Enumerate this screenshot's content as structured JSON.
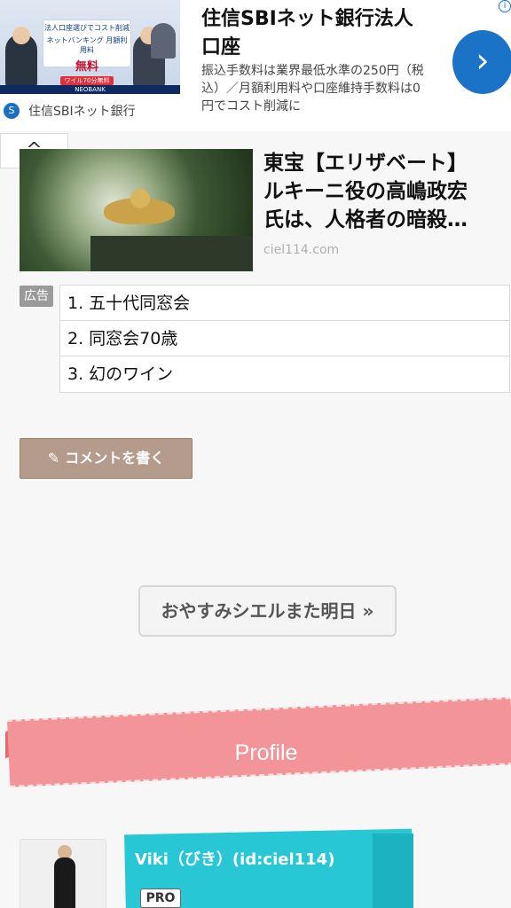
{
  "ad_banner": {
    "image_promo": {
      "line1": "法人口座選びでコスト削減",
      "line2": "ネットバンキング 月額利用料",
      "line3": "無料",
      "line4": "ワイル70分無料",
      "brand": "NEOBANK"
    },
    "title": "住信SBIネット銀行法人口座",
    "description": "振込手数料は業界最低水準の250円（税込）／月額利用料や口座維持手数料は0円でコスト削減に",
    "advertiser": "住信SBIネット銀行",
    "next_icon": "chevron-right-icon",
    "info_icon": "info-icon"
  },
  "collapse": {
    "icon": "chevron-up-icon",
    "glyph": "^"
  },
  "related_article": {
    "title_line1": "東宝【エリザベート】",
    "title_line2": "ルキーニ役の高嶋政宏",
    "title_line3": "氏は、人格者の暗殺…",
    "domain": "ciel114.com"
  },
  "ad_links": {
    "label": "広告",
    "items": [
      "1. 五十代同窓会",
      "2. 同窓会70歳",
      "3. 幻のワイン"
    ]
  },
  "comment_button": {
    "label": "コメントを書く",
    "icon": "pencil-icon"
  },
  "pager": {
    "next_label": "おやすみシエルまた明日 »"
  },
  "profile": {
    "section_title": "Profile",
    "name": "Viki（びき）(id:ciel114)",
    "badge": "PRO"
  },
  "colors": {
    "ad_next": "#1a73c6",
    "comment_button": "#b59b8c",
    "profile_ribbon": "#f39498",
    "name_box": "#28c7d6"
  }
}
